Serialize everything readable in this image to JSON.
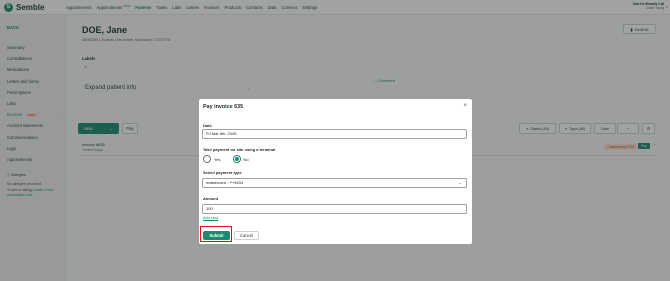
{
  "app": {
    "logo_letter": "S",
    "logo_text": "Semble"
  },
  "nav": {
    "items": [
      {
        "label": "Appointments"
      },
      {
        "label": "Appointments",
        "badge": "NEW"
      },
      {
        "label": "Patients",
        "active": true
      },
      {
        "label": "Tasks"
      },
      {
        "label": "Labs"
      },
      {
        "label": "Letters"
      },
      {
        "label": "Invoices"
      },
      {
        "label": "Products"
      },
      {
        "label": "Contacts"
      },
      {
        "label": "Data"
      },
      {
        "label": "Connect"
      },
      {
        "label": "Settings"
      }
    ],
    "org": "Clare's Beauty Ltd",
    "user": "Claire Young",
    "close": "×"
  },
  "sidebar": {
    "back": "BACK",
    "items": [
      {
        "label": "Summary"
      },
      {
        "label": "Consultations"
      },
      {
        "label": "Medications"
      },
      {
        "label": "Letters and forms"
      },
      {
        "label": "Prescriptions"
      },
      {
        "label": "Labs"
      },
      {
        "label": "Invoices",
        "badge": "£100",
        "active": true
      },
      {
        "label": "Account statements"
      },
      {
        "label": "Communications"
      },
      {
        "label": "Logs"
      },
      {
        "label": "Appointments"
      }
    ],
    "allergies": {
      "title": "Allergies",
      "none": "No allergies recorded",
      "note_prefix": "To add an allergy",
      "note_link": "create a new consultation note"
    }
  },
  "patient": {
    "name": "DOE, Jane",
    "meta": "08/06/2001 | 24 years | Sex at birth: Not known | 777237778"
  },
  "header_buttons": {
    "heidi": "Heidi AI"
  },
  "labels": {
    "title": "Labels"
  },
  "expand": {
    "label": "Expand patient info"
  },
  "comment": {
    "label": "Comment"
  },
  "toolbar": {
    "new": "New",
    "pay": "Pay",
    "status": "Status (All)",
    "type": "Type (All)",
    "date": "Date"
  },
  "invoice": {
    "title": "Invoice #635",
    "subtitle": "Created today",
    "outstanding": "Outstanding £100",
    "pay": "Pay"
  },
  "modal": {
    "title": "Pay invoice 635",
    "close": "×",
    "date_label": "Date",
    "date_value": "Fri Mar 6th, 2026",
    "terminal_label": "Take payment on site using a terminal",
    "yes": "Yes",
    "no": "No",
    "selected_terminal": "no",
    "payment_type_label": "Select payment type",
    "payment_type_value": "mastercard - ***4634",
    "amount_label": "Amount",
    "amount_value": "100",
    "add_card": "Add card",
    "submit": "Submit",
    "cancel": "Cancel"
  },
  "colors": {
    "accent": "#1c8a6e",
    "highlight": "#e01010",
    "outstanding_bg": "#ffe0d6"
  }
}
